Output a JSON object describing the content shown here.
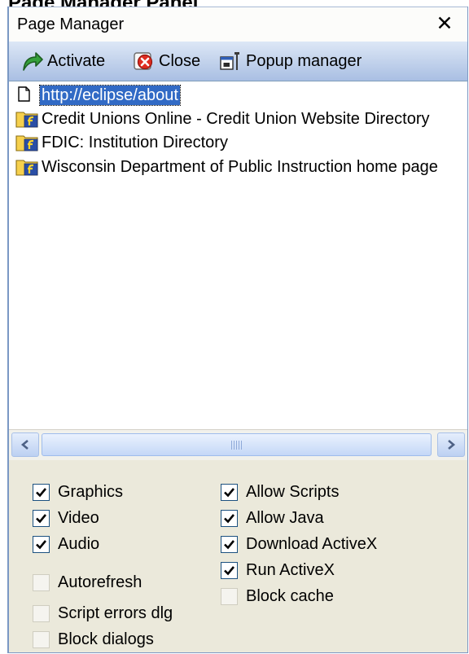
{
  "heading": "Page Manager Panel",
  "panel": {
    "title": "Page Manager",
    "close_glyph": "✕"
  },
  "toolbar": {
    "activate_label": "Activate",
    "activate_icon": "arrow-icon",
    "close_label": "Close",
    "close_icon": "close-icon",
    "popup_label": "Popup manager",
    "popup_icon": "popup-manager-icon"
  },
  "pages": [
    {
      "label": "http://eclipse/about",
      "icon": "page-icon",
      "selected": true
    },
    {
      "label": "Credit Unions Online - Credit Union Website Directory",
      "icon": "folder-icon",
      "selected": false
    },
    {
      "label": "FDIC: Institution Directory",
      "icon": "folder-icon",
      "selected": false
    },
    {
      "label": "Wisconsin Department of Public Instruction home page",
      "icon": "folder-icon",
      "selected": false
    }
  ],
  "scrollbar": {
    "position": 0.0
  },
  "options": {
    "left": [
      {
        "label": "Graphics",
        "checked": true
      },
      {
        "label": "Video",
        "checked": true
      },
      {
        "label": "Audio",
        "checked": true
      },
      {
        "label": "Autorefresh",
        "checked": false
      },
      {
        "label": "Script errors dlg",
        "checked": false
      },
      {
        "label": "Block dialogs",
        "checked": false
      }
    ],
    "right": [
      {
        "label": "Allow Scripts",
        "checked": true
      },
      {
        "label": "Allow Java",
        "checked": true
      },
      {
        "label": "Download ActiveX",
        "checked": true
      },
      {
        "label": "Run ActiveX",
        "checked": true
      },
      {
        "label": "Block cache",
        "checked": false
      }
    ]
  },
  "colors": {
    "selection": "#316ac5",
    "panel_border": "#7a98c4",
    "options_bg": "#ebe9db"
  }
}
